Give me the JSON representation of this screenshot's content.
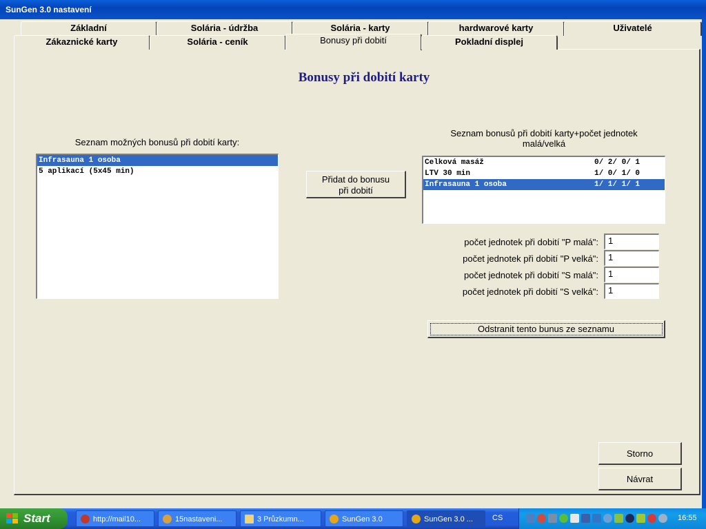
{
  "window": {
    "title": "SunGen 3.0 nastavení"
  },
  "tabs_row1": [
    "Základní",
    "Solária - údržba",
    "Solária - karty",
    "hardwarové karty",
    "Uživatelé"
  ],
  "tabs_row2": [
    "Zákaznické karty",
    "Solária - ceník",
    "Bonusy při dobití",
    "Pokladní displej"
  ],
  "active_tab": "Bonusy při dobití",
  "page_title": "Bonusy při dobití karty",
  "available": {
    "label": "Seznam možných bonusů při dobití karty:",
    "items": [
      "Infrasauna 1 osoba",
      "5 aplikací (5x45 min)"
    ],
    "selected": "Infrasauna 1 osoba"
  },
  "add_button": {
    "line1": "Přidat do bonusu",
    "line2": "při dobití"
  },
  "assigned": {
    "label_line1": "Seznam bonusů při dobití karty+počet jednotek",
    "label_line2": "malá/velká",
    "items": [
      {
        "name": "Celková masáž",
        "counts": "0/ 2/ 0/ 1"
      },
      {
        "name": "LTV 30 min",
        "counts": "1/ 0/ 1/ 0"
      },
      {
        "name": "Infrasauna 1 osoba",
        "counts": "1/ 1/ 1/ 1"
      }
    ],
    "selected": "Infrasauna 1 osoba"
  },
  "fields": [
    {
      "label": "počet jednotek při dobití \"P malá\":",
      "value": "1"
    },
    {
      "label": "počet jednotek při dobití \"P velká\":",
      "value": "1"
    },
    {
      "label": "počet jednotek při dobití \"S malá\":",
      "value": "1"
    },
    {
      "label": "počet jednotek při dobití \"S velká\":",
      "value": "1"
    }
  ],
  "remove_button": "Odstranit tento bunus ze seznamu",
  "storno_button": "Storno",
  "navrat_button": "Návrat",
  "taskbar": {
    "start": "Start",
    "tasks": [
      "http://mail10...",
      "15nastaveni...",
      "3 Průzkumn...",
      "SunGen 3.0",
      "SunGen 3.0 ..."
    ],
    "language": "CS",
    "clock": "16:55"
  },
  "colors": {
    "selection": "#316ac5",
    "title_text": "#1c1c8c",
    "titlebar": "#0a52c8"
  }
}
